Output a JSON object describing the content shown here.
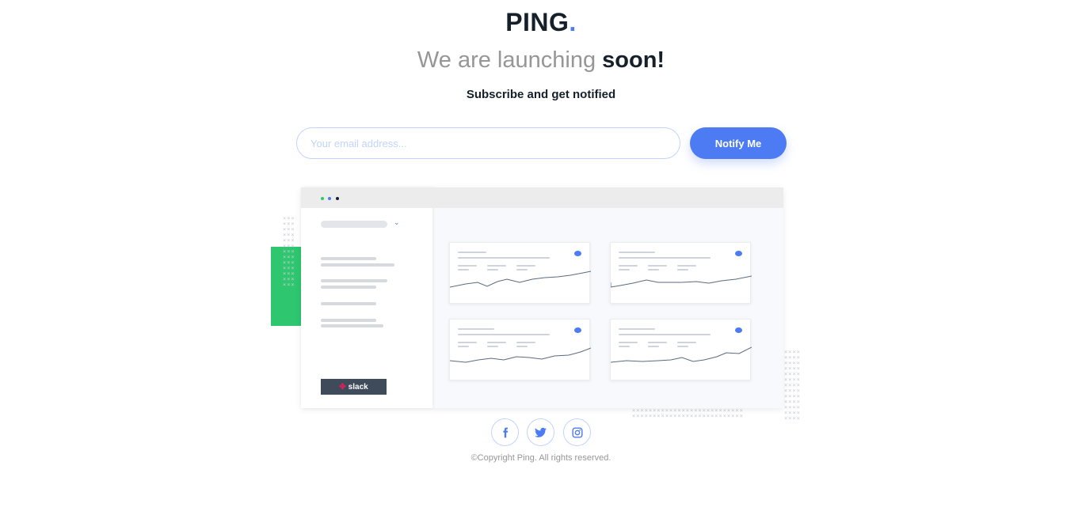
{
  "brand": {
    "name": "PING",
    "dot": "."
  },
  "headline": {
    "light": "We are launching ",
    "bold": "soon!"
  },
  "subheading": "Subscribe and get notified",
  "form": {
    "email_placeholder": "Your email address...",
    "button_label": "Notify Me"
  },
  "dashboard": {
    "slack_label": "slack"
  },
  "social": [
    {
      "name": "facebook",
      "icon": "facebook-icon"
    },
    {
      "name": "twitter",
      "icon": "twitter-icon"
    },
    {
      "name": "instagram",
      "icon": "instagram-icon"
    }
  ],
  "footer": {
    "copyright": "©Copyright Ping. All rights reserved."
  },
  "colors": {
    "accent": "#4c7bf3",
    "pale_blue": "#c2d3ff",
    "dark": "#15202a",
    "gray": "#969696",
    "green": "#2ec770"
  }
}
